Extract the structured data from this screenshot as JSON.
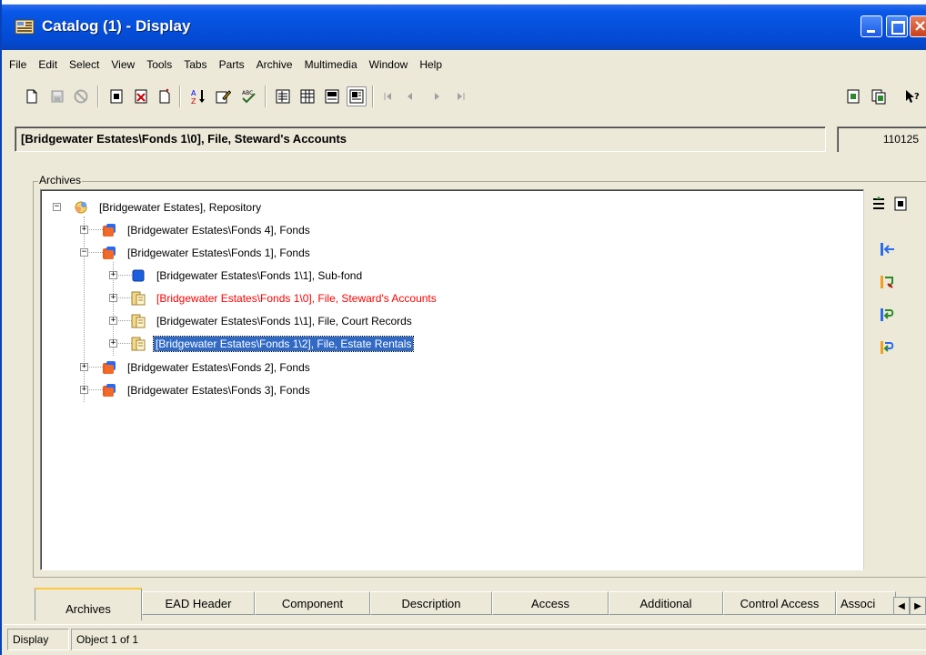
{
  "window": {
    "title": "Catalog (1) - Display",
    "icon": "catalog-app-icon"
  },
  "menubar": {
    "items": [
      {
        "label": "File"
      },
      {
        "label": "Edit"
      },
      {
        "label": "Select"
      },
      {
        "label": "View"
      },
      {
        "label": "Tools"
      },
      {
        "label": "Tabs"
      },
      {
        "label": "Parts"
      },
      {
        "label": "Archive"
      },
      {
        "label": "Multimedia"
      },
      {
        "label": "Window"
      },
      {
        "label": "Help"
      }
    ]
  },
  "toolbar": {
    "buttons": [
      "new-record-icon",
      "save-icon",
      "cancel-disabled-icon",
      "copy-record-icon",
      "delete-record-icon",
      "new-blank-icon",
      "sort-icon",
      "edit-record-icon",
      "spellcheck-icon",
      "view-list-icon",
      "view-table-icon",
      "view-form-icon",
      "view-page-icon",
      "first-record-icon",
      "previous-record-icon",
      "next-record-icon",
      "last-record-icon",
      "report-green-icon",
      "report-blue-icon",
      "help-pointer-icon"
    ],
    "pressed": "view-page-icon"
  },
  "record": {
    "title": "[Bridgewater Estates\\Fonds 1\\0], File, Steward's Accounts",
    "id": "110125"
  },
  "archives": {
    "group_label": "Archives",
    "tree": [
      {
        "label": "[Bridgewater Estates], Repository",
        "icon": "repository-icon",
        "level": 0,
        "expander": "−"
      },
      {
        "label": "[Bridgewater Estates\\Fonds 4], Fonds",
        "icon": "fonds-icon",
        "level": 1,
        "expander": "+"
      },
      {
        "label": "[Bridgewater Estates\\Fonds 1], Fonds",
        "icon": "fonds-icon",
        "level": 1,
        "expander": "−"
      },
      {
        "label": "[Bridgewater Estates\\Fonds 1\\1], Sub-fond",
        "icon": "subfond-icon",
        "level": 2,
        "expander": "+"
      },
      {
        "label": "[Bridgewater Estates\\Fonds 1\\0], File, Steward's Accounts",
        "icon": "file-icon",
        "level": 2,
        "expander": "+",
        "state": "current"
      },
      {
        "label": "[Bridgewater Estates\\Fonds 1\\1], File, Court Records",
        "icon": "file-icon",
        "level": 2,
        "expander": "+"
      },
      {
        "label": "[Bridgewater Estates\\Fonds 1\\2], File, Estate Rentals",
        "icon": "file-icon",
        "level": 2,
        "expander": "+",
        "state": "selected"
      },
      {
        "label": "[Bridgewater Estates\\Fonds 2], Fonds",
        "icon": "fonds-icon",
        "level": 1,
        "expander": "+"
      },
      {
        "label": "[Bridgewater Estates\\Fonds 3], Fonds",
        "icon": "fonds-icon",
        "level": 1,
        "expander": "+"
      }
    ],
    "side_tools": [
      "expand-all-icon",
      "new-node-icon",
      "move-in-icon",
      "move-edit-icon",
      "move-down-icon",
      "move-out-icon"
    ]
  },
  "tabs": {
    "items": [
      {
        "label": "Archives"
      },
      {
        "label": "EAD Header"
      },
      {
        "label": "Component"
      },
      {
        "label": "Description"
      },
      {
        "label": "Access"
      },
      {
        "label": "Additional"
      },
      {
        "label": "Control Access"
      },
      {
        "label": "Associ"
      }
    ],
    "active": "Archives"
  },
  "status": {
    "mode": "Display",
    "object": "Object 1 of 1"
  },
  "colors": {
    "titlebar": "#0550dc",
    "selection": "#316ac5",
    "current_record_text": "#ff0000",
    "active_tab_accent": "#ffc83c"
  }
}
